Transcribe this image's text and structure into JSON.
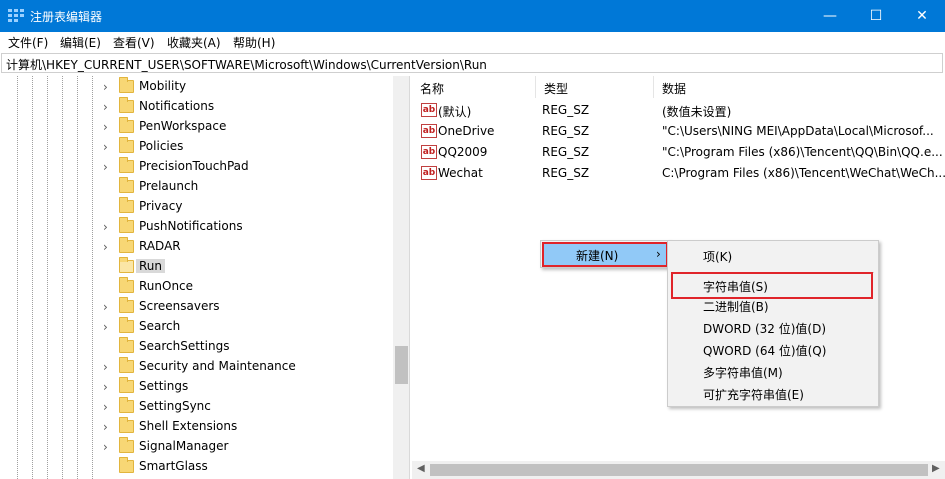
{
  "window": {
    "title": "注册表编辑器",
    "minimize_glyph": "—",
    "maximize_glyph": "☐",
    "close_glyph": "✕",
    "accent_color": "#0078d7"
  },
  "menubar": {
    "items": [
      {
        "label": "文件(F)"
      },
      {
        "label": "编辑(E)"
      },
      {
        "label": "查看(V)"
      },
      {
        "label": "收藏夹(A)"
      },
      {
        "label": "帮助(H)"
      }
    ]
  },
  "address": {
    "path": "计算机\\HKEY_CURRENT_USER\\SOFTWARE\\Microsoft\\Windows\\CurrentVersion\\Run"
  },
  "tree": {
    "items": [
      {
        "label": "Mobility",
        "expandable": true
      },
      {
        "label": "Notifications",
        "expandable": true
      },
      {
        "label": "PenWorkspace",
        "expandable": true
      },
      {
        "label": "Policies",
        "expandable": true
      },
      {
        "label": "PrecisionTouchPad",
        "expandable": true
      },
      {
        "label": "Prelaunch",
        "expandable": false
      },
      {
        "label": "Privacy",
        "expandable": false
      },
      {
        "label": "PushNotifications",
        "expandable": true
      },
      {
        "label": "RADAR",
        "expandable": true
      },
      {
        "label": "Run",
        "expandable": false,
        "selected": true
      },
      {
        "label": "RunOnce",
        "expandable": false
      },
      {
        "label": "Screensavers",
        "expandable": true
      },
      {
        "label": "Search",
        "expandable": true
      },
      {
        "label": "SearchSettings",
        "expandable": false
      },
      {
        "label": "Security and Maintenance",
        "expandable": true
      },
      {
        "label": "Settings",
        "expandable": true
      },
      {
        "label": "SettingSync",
        "expandable": true
      },
      {
        "label": "Shell Extensions",
        "expandable": true
      },
      {
        "label": "SignalManager",
        "expandable": true
      },
      {
        "label": "SmartGlass",
        "expandable": false
      }
    ]
  },
  "list": {
    "columns": {
      "name": "名称",
      "type": "类型",
      "data": "数据"
    },
    "rows": [
      {
        "name": "(默认)",
        "type": "REG_SZ",
        "data": "(数值未设置)"
      },
      {
        "name": "OneDrive",
        "type": "REG_SZ",
        "data": "\"C:\\Users\\NING MEI\\AppData\\Local\\Microsof..."
      },
      {
        "name": "QQ2009",
        "type": "REG_SZ",
        "data": "\"C:\\Program Files (x86)\\Tencent\\QQ\\Bin\\QQ.e..."
      },
      {
        "name": "Wechat",
        "type": "REG_SZ",
        "data": "C:\\Program Files (x86)\\Tencent\\WeChat\\WeCh..."
      }
    ],
    "row_icon_text": "ab"
  },
  "context_menu": {
    "new_label": "新建(N)",
    "arrow": "›"
  },
  "submenu": {
    "items": [
      {
        "label": "项(K)"
      },
      {
        "label": "字符串值(S)",
        "highlighted": true
      },
      {
        "label": "二进制值(B)"
      },
      {
        "label": "DWORD (32 位)值(D)"
      },
      {
        "label": "QWORD (64 位)值(Q)"
      },
      {
        "label": "多字符串值(M)"
      },
      {
        "label": "可扩充字符串值(E)"
      }
    ]
  },
  "colors": {
    "highlight_box": "#e0242a",
    "menu_selection": "#91c9f7",
    "folder": "#f8d775"
  }
}
